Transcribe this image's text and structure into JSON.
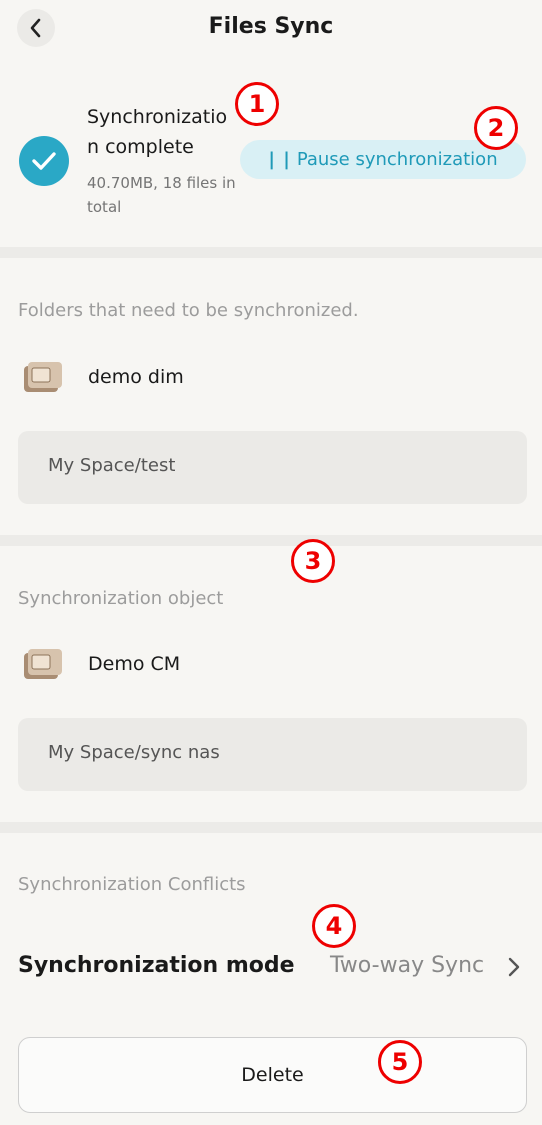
{
  "header": {
    "title": "Files Sync",
    "back_icon": "chevron-left-icon"
  },
  "status": {
    "title": "Synchronization complete",
    "summary": "40.70MB, 18 files in total",
    "pause_label": "Pause synchronization",
    "pause_icon": "| |",
    "accent": "#2aa8c6"
  },
  "source": {
    "label": "Folders that need to be synchronized.",
    "device_name": "demo dim",
    "path": "My Space/test"
  },
  "target": {
    "label": "Synchronization object",
    "device_name": "Demo CM",
    "path": "My Space/sync nas"
  },
  "conflicts": {
    "label": "Synchronization Conflicts",
    "mode_label": "Synchronization mode",
    "mode_value": "Two-way Sync"
  },
  "actions": {
    "delete_label": "Delete"
  },
  "markers": [
    "1",
    "2",
    "3",
    "4",
    "5"
  ]
}
